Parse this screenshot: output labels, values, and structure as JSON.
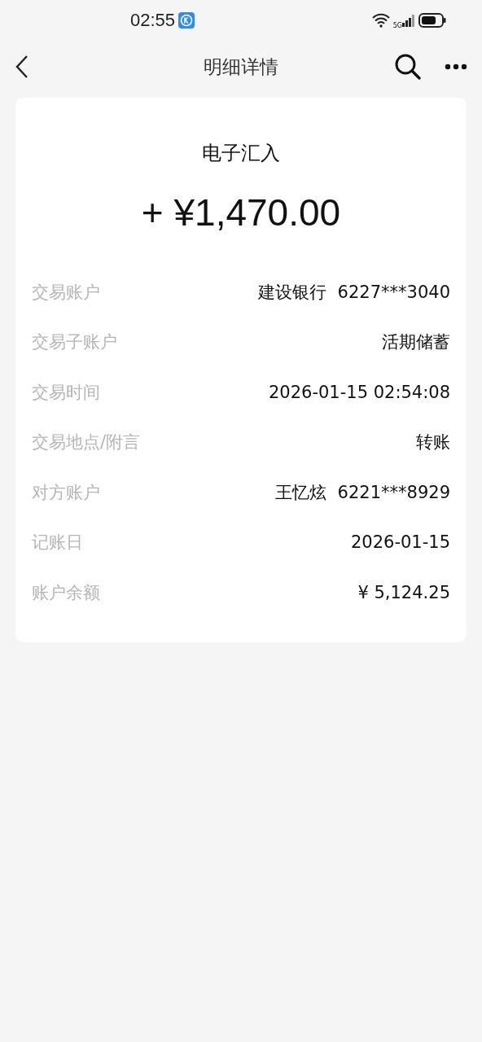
{
  "status_bar": {
    "time": "02:55",
    "network": "5G"
  },
  "nav": {
    "title": "明细详情"
  },
  "card": {
    "type": "电子汇入",
    "amount": "+ ¥1,470.00",
    "rows": [
      {
        "label": "交易账户",
        "value": "建设银行  6227***3040"
      },
      {
        "label": "交易子账户",
        "value": "活期储蓄"
      },
      {
        "label": "交易时间",
        "value": "2026-01-15 02:54:08"
      },
      {
        "label": "交易地点/附言",
        "value": "转账"
      },
      {
        "label": "对方账户",
        "value": "王忆炫  6221***8929"
      },
      {
        "label": "记账日",
        "value": "2026-01-15"
      },
      {
        "label": "账户余额",
        "value": "¥ 5,124.25"
      }
    ]
  }
}
